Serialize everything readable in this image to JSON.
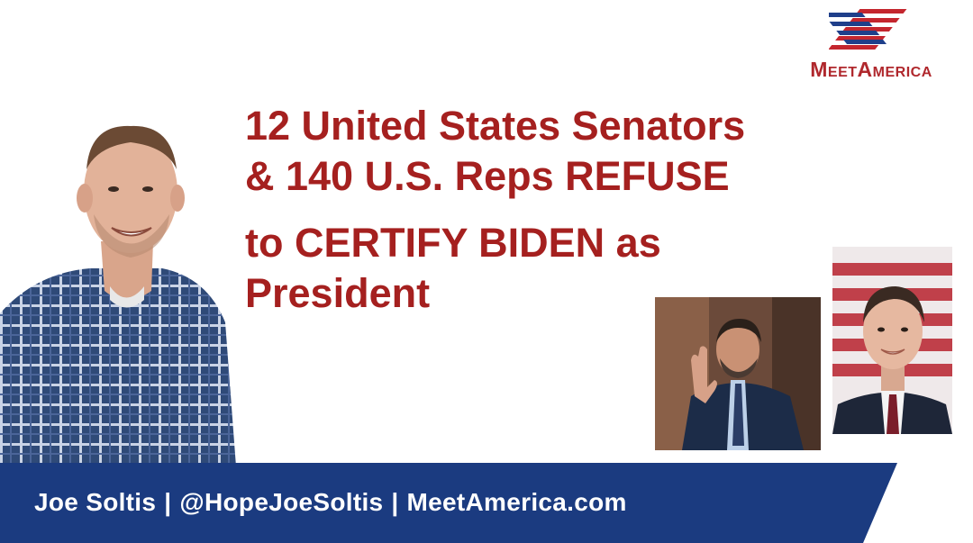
{
  "logo": {
    "text": "MeetAmerica",
    "colors": {
      "blue": "#1f3f8a",
      "red": "#c4262e"
    }
  },
  "headline": {
    "lines": [
      "12 United States Senators",
      "& 140 U.S. Reps REFUSE",
      "to CERTIFY BIDEN as",
      "President"
    ],
    "color": "#a5201f"
  },
  "banner": {
    "name": "Joe Soltis",
    "handle": "@HopeJoeSoltis",
    "site": "MeetAmerica.com",
    "separator": "|",
    "background": "#1b3b80"
  },
  "photos": {
    "host": "person-portrait-plaid-shirt",
    "senator_left": "person-portrait-raising-hand",
    "senator_right": "person-portrait-flag-background"
  }
}
